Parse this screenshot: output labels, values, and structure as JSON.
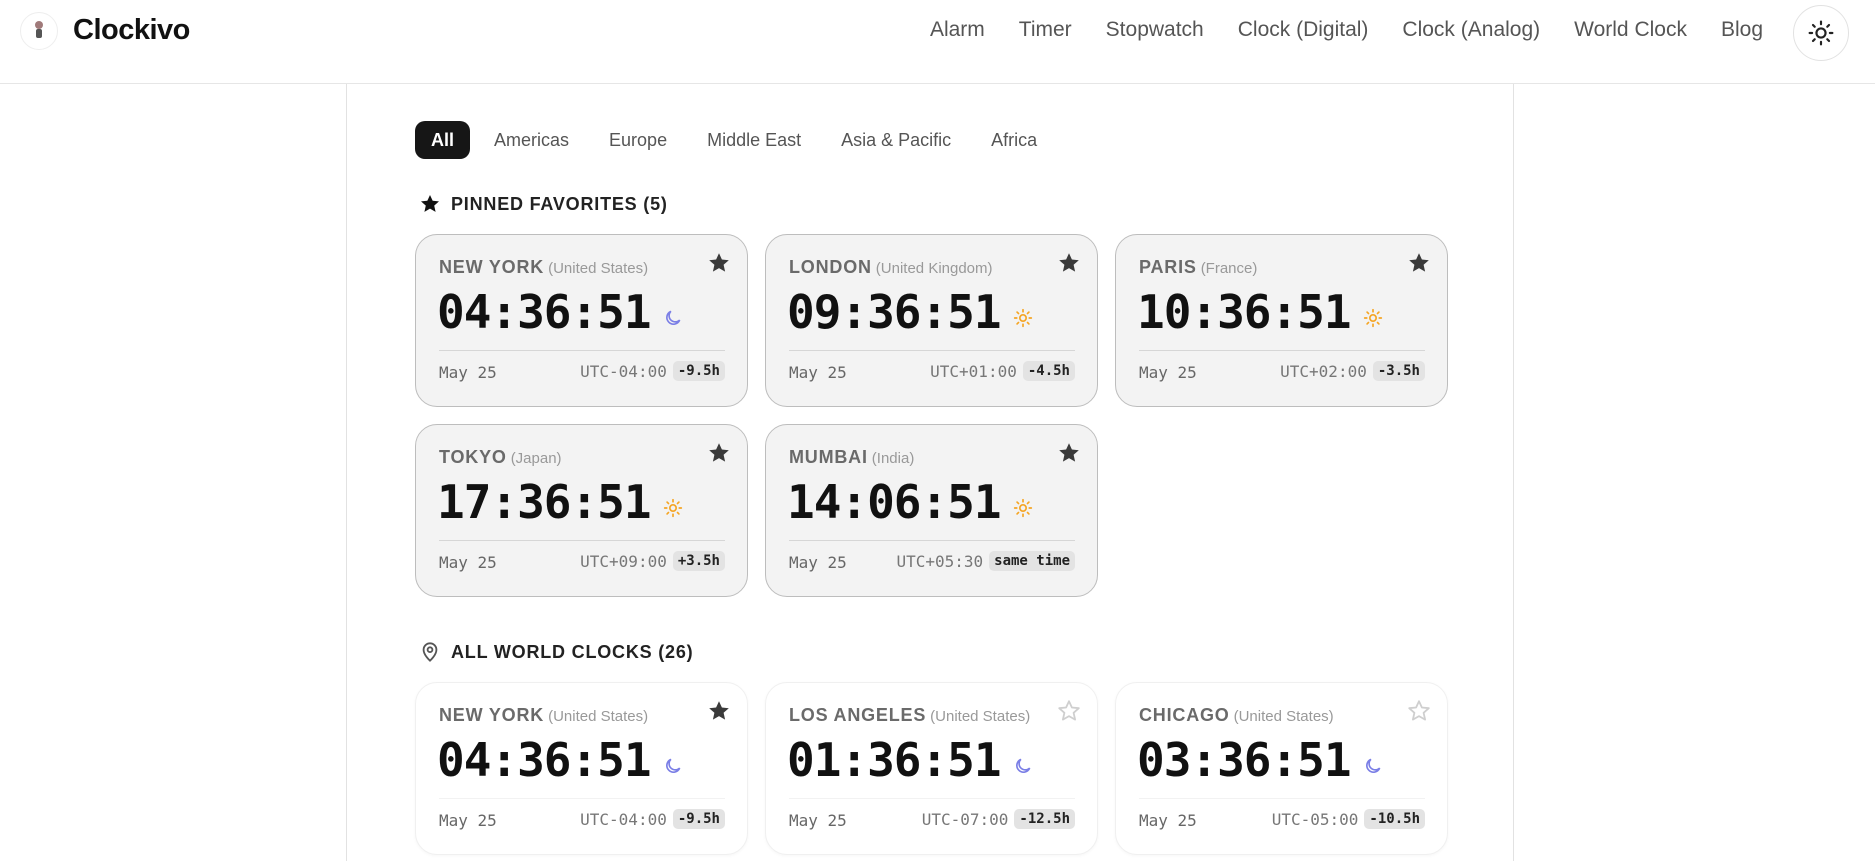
{
  "app": {
    "brand": "Clockivo"
  },
  "nav": {
    "items": [
      {
        "label": "Alarm"
      },
      {
        "label": "Timer"
      },
      {
        "label": "Stopwatch"
      },
      {
        "label": "Clock (Digital)"
      },
      {
        "label": "Clock (Analog)"
      },
      {
        "label": "World Clock"
      },
      {
        "label": "Blog"
      }
    ],
    "theme_icon": "sun-icon"
  },
  "filters": [
    {
      "label": "All",
      "active": true
    },
    {
      "label": "Americas",
      "active": false
    },
    {
      "label": "Europe",
      "active": false
    },
    {
      "label": "Middle East",
      "active": false
    },
    {
      "label": "Asia & Pacific",
      "active": false
    },
    {
      "label": "Africa",
      "active": false
    }
  ],
  "pinned": {
    "title": "PINNED FAVORITES (5)",
    "icon": "star-icon",
    "cards": [
      {
        "city": "NEW YORK",
        "country": "(United States)",
        "time": "04:36:51",
        "tod": "moon",
        "date": "May 25",
        "utc": "UTC-04:00",
        "diff": "-9.5h",
        "starred": true
      },
      {
        "city": "LONDON",
        "country": "(United Kingdom)",
        "time": "09:36:51",
        "tod": "sun",
        "date": "May 25",
        "utc": "UTC+01:00",
        "diff": "-4.5h",
        "starred": true
      },
      {
        "city": "PARIS",
        "country": "(France)",
        "time": "10:36:51",
        "tod": "sun",
        "date": "May 25",
        "utc": "UTC+02:00",
        "diff": "-3.5h",
        "starred": true
      },
      {
        "city": "TOKYO",
        "country": "(Japan)",
        "time": "17:36:51",
        "tod": "sun",
        "date": "May 25",
        "utc": "UTC+09:00",
        "diff": "+3.5h",
        "starred": true
      },
      {
        "city": "MUMBAI",
        "country": "(India)",
        "time": "14:06:51",
        "tod": "sun",
        "date": "May 25",
        "utc": "UTC+05:30",
        "diff": "same time",
        "starred": true
      }
    ]
  },
  "all": {
    "title": "ALL WORLD CLOCKS (26)",
    "icon": "location-pin-icon",
    "cards": [
      {
        "city": "NEW YORK",
        "country": "(United States)",
        "time": "04:36:51",
        "tod": "moon",
        "date": "May 25",
        "utc": "UTC-04:00",
        "diff": "-9.5h",
        "starred": true
      },
      {
        "city": "LOS ANGELES",
        "country": "(United States)",
        "time": "01:36:51",
        "tod": "moon",
        "date": "May 25",
        "utc": "UTC-07:00",
        "diff": "-12.5h",
        "starred": false
      },
      {
        "city": "CHICAGO",
        "country": "(United States)",
        "time": "03:36:51",
        "tod": "moon",
        "date": "May 25",
        "utc": "UTC-05:00",
        "diff": "-10.5h",
        "starred": false
      }
    ]
  },
  "colors": {
    "accent_dark": "#161616",
    "moon": "#7b7fe6",
    "sun": "#f5a524",
    "star_filled": "#3a3a3a",
    "star_outline": "#cfcfcf"
  }
}
